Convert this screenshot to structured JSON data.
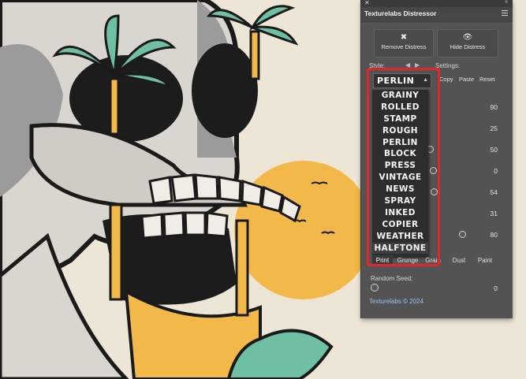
{
  "panel": {
    "close_glyph": "✕",
    "collapse_glyph": "«",
    "title": "Texturelabs Distressor",
    "remove_distress": "Remove Distress",
    "hide_distress": "Hide Distress",
    "style_label": "Style:",
    "settings_label": "Settings:",
    "copy_label": "Copy",
    "paste_label": "Paste",
    "reset_label": "Reset",
    "selected_style": "PERLIN",
    "style_options": [
      "GRAINY",
      "ROLLED",
      "STAMP",
      "ROUGH",
      "PERLIN",
      "BLOCK",
      "PRESS",
      "VINTAGE",
      "NEWS",
      "SPRAY",
      "INKED",
      "COPIER",
      "WEATHER",
      "HALFTONE"
    ],
    "setting_values": [
      "90",
      "25",
      "50",
      "0",
      "54",
      "31",
      "80"
    ],
    "tabs": [
      "Print",
      "Grunge",
      "Grain",
      "Dust",
      "Paint"
    ],
    "active_tab": "Print",
    "random_seed_label": "Random Seed:",
    "random_seed_value": "0",
    "copyright": "Texturelabs © 2024",
    "prev_arrow": "◀",
    "next_arrow": "▶"
  },
  "colors": {
    "panel_bg": "#535353",
    "highlight_red": "#e0262b",
    "palm_teal": "#6fbfa4",
    "sun_yellow": "#f2b94a",
    "ink": "#1a1a1a"
  }
}
